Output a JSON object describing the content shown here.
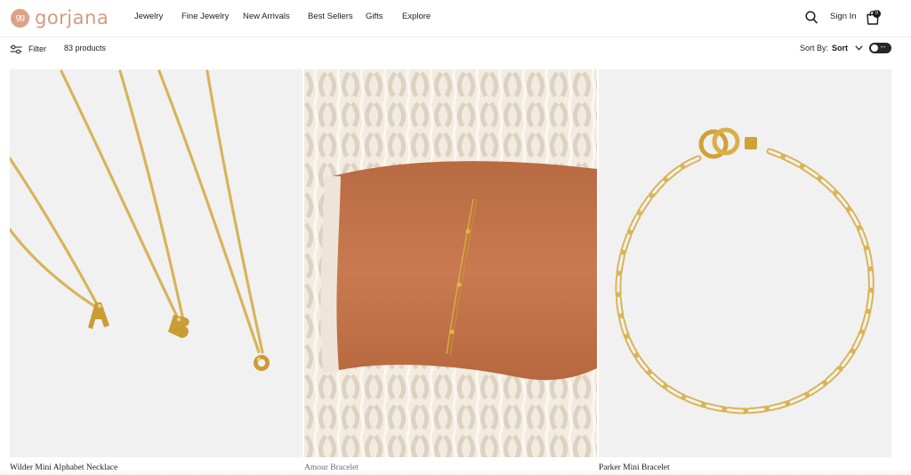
{
  "header": {
    "logo_text": "gorjana",
    "logo_mark": "gg",
    "nav": [
      "Jewelry",
      "Fine Jewelry",
      "New Arrivals",
      "Best Sellers",
      "Gifts",
      "Explore"
    ],
    "search_icon": "search-icon",
    "signin_label": "Sign In",
    "bag_icon": "shopping-bag-icon",
    "bag_count": "0",
    "brand_color": "#d29c82"
  },
  "toolbar": {
    "filter_label": "Filter",
    "filter_icon": "sliders-icon",
    "count_label": "83 products",
    "sort_by_label": "Sort By:",
    "sort_value": "Sort",
    "sort_icon": "chevron-down-icon",
    "view_toggle_icon": "grid-toggle-icon"
  },
  "products": [
    {
      "name": "Wilder Mini Alphabet Necklace"
    },
    {
      "name": "Amour Bracelet"
    },
    {
      "name": "Parker Mini Bracelet"
    }
  ]
}
